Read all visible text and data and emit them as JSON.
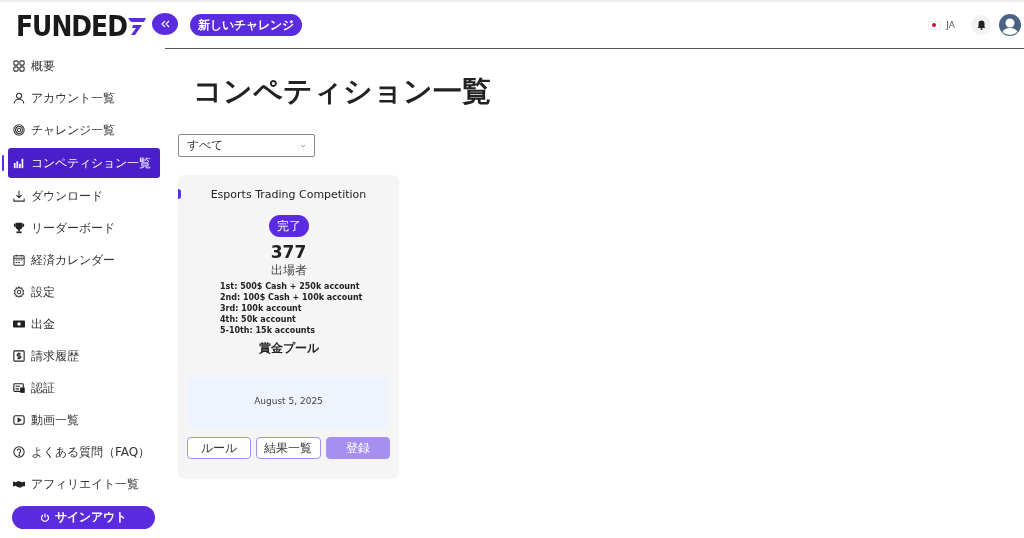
{
  "logo": {
    "text": "FUNDED"
  },
  "header": {
    "new_challenge_button": "新しいチャレンジ",
    "language": "JA"
  },
  "sidebar": {
    "items": [
      {
        "label": "概要",
        "selected": false
      },
      {
        "label": "アカウント一覧",
        "selected": false
      },
      {
        "label": "チャレンジ一覧",
        "selected": false
      },
      {
        "label": "コンペティション一覧",
        "selected": true
      },
      {
        "label": "ダウンロード",
        "selected": false
      },
      {
        "label": "リーダーボード",
        "selected": false
      },
      {
        "label": "経済カレンダー",
        "selected": false
      },
      {
        "label": "設定",
        "selected": false
      },
      {
        "label": "出金",
        "selected": false
      },
      {
        "label": "請求履歴",
        "selected": false
      },
      {
        "label": "認証",
        "selected": false
      },
      {
        "label": "動画一覧",
        "selected": false
      },
      {
        "label": "よくある質問（FAQ）",
        "selected": false
      },
      {
        "label": "アフィリエイト一覧",
        "selected": false
      }
    ],
    "sign_out": "サインアウト"
  },
  "page_title": "コンペティション一覧",
  "filter": {
    "value": "すべて"
  },
  "competitions": [
    {
      "title": "Esports Trading Competition",
      "status": "完了",
      "participants": "377",
      "participants_label": "出場者",
      "prizes": [
        "1st: 500$ Cash + 250k account",
        "2nd: 100$ Cash + 100k account",
        "3rd: 100k account",
        "4th: 50k account",
        "5-10th: 15k accounts"
      ],
      "prize_label": "賞金プール",
      "date": "August 5, 2025",
      "buttons": [
        {
          "label": "ルール",
          "disabled": false
        },
        {
          "label": "結果一覧",
          "disabled": false
        },
        {
          "label": "登録",
          "disabled": true
        }
      ]
    }
  ]
}
